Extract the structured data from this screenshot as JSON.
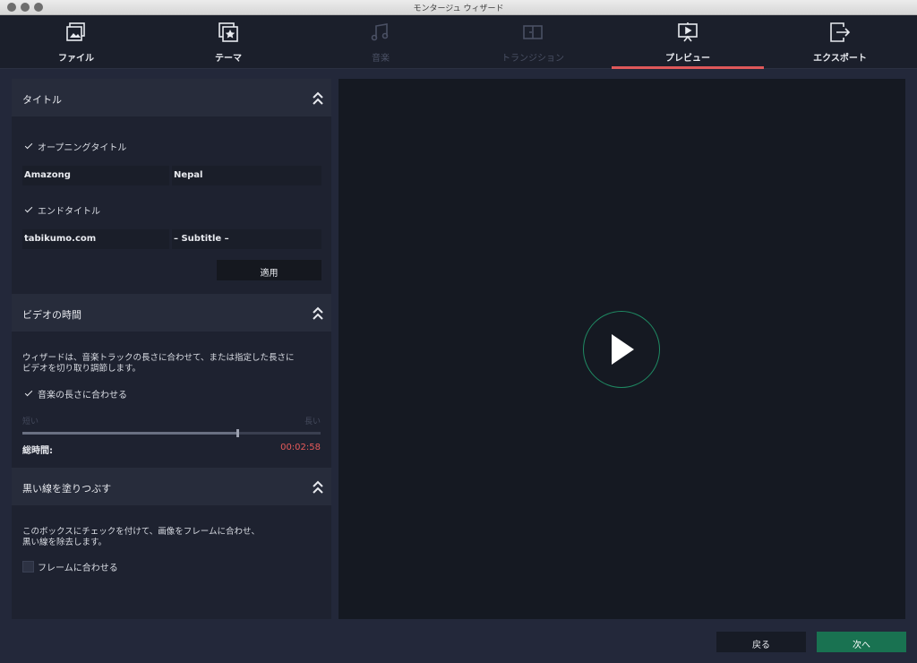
{
  "window": {
    "title": "モンタージュ ウィザード"
  },
  "tabs": [
    {
      "label": "ファイル",
      "icon": "file-media-icon",
      "state": "enabled"
    },
    {
      "label": "テーマ",
      "icon": "theme-star-icon",
      "state": "enabled"
    },
    {
      "label": "音楽",
      "icon": "music-note-icon",
      "state": "disabled"
    },
    {
      "label": "トランジション",
      "icon": "transition-icon",
      "state": "disabled"
    },
    {
      "label": "プレビュー",
      "icon": "preview-play-icon",
      "state": "active"
    },
    {
      "label": "エクスポート",
      "icon": "export-icon",
      "state": "enabled"
    }
  ],
  "title_section": {
    "heading": "タイトル",
    "opening_checkbox_label": "オープニングタイトル",
    "opening_title": "Amazong",
    "opening_subtitle": "Nepal",
    "ending_checkbox_label": "エンドタイトル",
    "ending_title": "tabikumo.com",
    "ending_subtitle": "– Subtitle –",
    "apply_label": "適用"
  },
  "duration_section": {
    "heading": "ビデオの時間",
    "description_line1": "ウィザードは、音楽トラックの長さに合わせて、または指定した長さに",
    "description_line2": "ビデオを切り取り調節します。",
    "fit_music_label": "音楽の長さに合わせる",
    "short_label": "短い",
    "long_label": "長い",
    "slider_level": 0.72,
    "total_label": "総時間:",
    "total_time": "00:02:58"
  },
  "blackbar_section": {
    "heading": "黒い線を塗りつぶす",
    "description_line1": "このボックスにチェックを付けて、画像をフレームに合わせ、",
    "description_line2": "黒い線を除去します。",
    "fit_frame_label": "フレームに合わせる"
  },
  "footer": {
    "back_label": "戻る",
    "next_label": "次へ"
  },
  "colors": {
    "accent_active_tab": "#e0585a",
    "play_ring": "#1f8a63",
    "next_button": "#197251",
    "time_text": "#e65a5a"
  }
}
